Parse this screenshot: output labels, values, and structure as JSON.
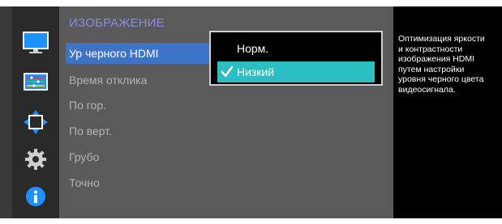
{
  "menu": {
    "title": "ИЗОБРАЖЕНИЕ",
    "items": [
      {
        "label": "Ур черного HDMI",
        "selected": true
      },
      {
        "label": "Время отклика",
        "selected": false
      },
      {
        "label": "По гор.",
        "selected": false
      },
      {
        "label": "По верт.",
        "selected": false
      },
      {
        "label": "Грубо",
        "selected": false
      },
      {
        "label": "Точно",
        "selected": false
      }
    ]
  },
  "submenu": {
    "options": [
      {
        "label": "Норм.",
        "checked": false
      },
      {
        "label": "Низкий",
        "checked": true
      }
    ]
  },
  "sidebar": {
    "icons": [
      "monitor-icon",
      "color-bars-icon",
      "move-arrows-icon",
      "gear-icon",
      "info-icon"
    ]
  },
  "info": {
    "text": "Оптимизация яркости\nи контрастности\nизображения HDMI\nпутем настройки\nуровня черного цвета\nвидеосигнала."
  },
  "colors": {
    "title": "#8a8ae6",
    "selected_item": "#3e74c8",
    "active_option": "#2bbfc2",
    "sidebar_accent": "#1e90ff"
  }
}
